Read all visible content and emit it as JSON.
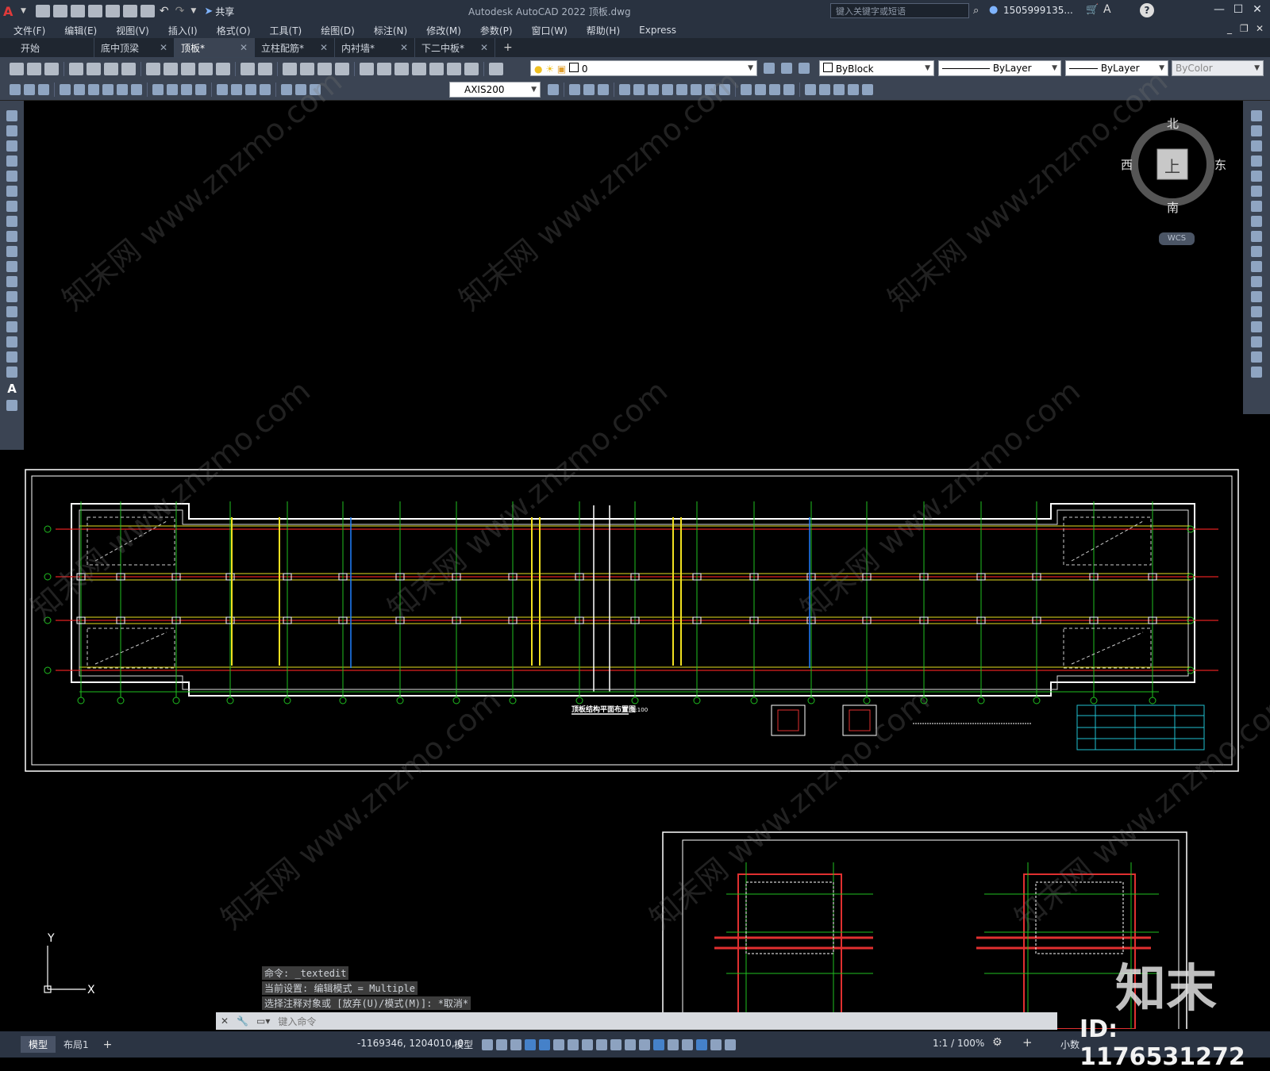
{
  "app": {
    "title": "Autodesk AutoCAD 2022    顶板.dwg",
    "share_label": "共享",
    "search_placeholder": "键入关键字或短语",
    "user": "1505999135...",
    "logo": "A"
  },
  "menu": [
    "文件(F)",
    "编辑(E)",
    "视图(V)",
    "插入(I)",
    "格式(O)",
    "工具(T)",
    "绘图(D)",
    "标注(N)",
    "修改(M)",
    "参数(P)",
    "窗口(W)",
    "帮助(H)",
    "Express"
  ],
  "tabs": [
    {
      "label": "开始",
      "active": false
    },
    {
      "label": "底中顶梁",
      "active": false
    },
    {
      "label": "顶板*",
      "active": true
    },
    {
      "label": "立柱配筋*",
      "active": false
    },
    {
      "label": "内衬墙*",
      "active": false
    },
    {
      "label": "下二中板*",
      "active": false
    }
  ],
  "toolbar": {
    "layer": "0",
    "color": "ByBlock",
    "linetype": "ByLayer",
    "lineweight": "ByLayer",
    "plotstyle": "ByColor",
    "dimstyle": "AXIS200"
  },
  "viewcube": {
    "north": "北",
    "south": "南",
    "east": "东",
    "west": "西",
    "face": "上",
    "wcs": "WCS"
  },
  "drawing": {
    "plan_title": "顶板结构平面布置图",
    "plan_scale": "1:100",
    "ucs_x": "X",
    "ucs_y": "Y"
  },
  "command": {
    "history": [
      "命令: _textedit",
      "当前设置: 编辑模式 = Multiple",
      "选择注释对象或 [放弃(U)/模式(M)]: *取消*"
    ],
    "prompt": "键入命令"
  },
  "layouts": [
    {
      "label": "模型",
      "active": true
    },
    {
      "label": "布局1",
      "active": false
    }
  ],
  "status": {
    "coords": "-1169346, 1204010, 0",
    "model": "模型",
    "scale": "1:1 / 100%",
    "units": "小数"
  },
  "watermark": {
    "site": "知末网 www.znzmo.com",
    "logo": "知末",
    "id": "ID: 1176531272"
  }
}
